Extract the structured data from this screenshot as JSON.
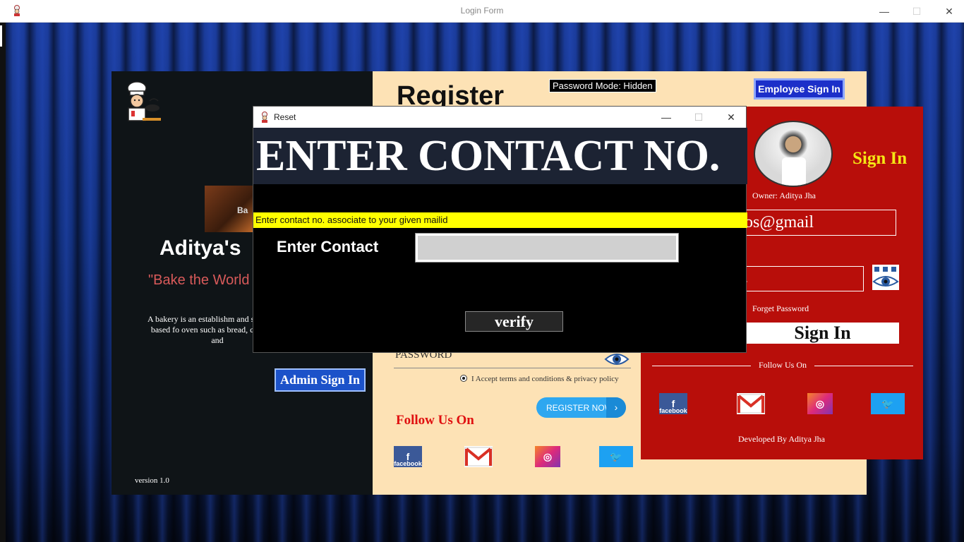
{
  "window": {
    "title": "Login Form",
    "minimize": "—",
    "maximize": "☐",
    "close": "✕"
  },
  "left_panel": {
    "bakery_img_text": "Ba",
    "bakery_name": "Aditya's",
    "tagline": "\"Bake the World",
    "description": "A bakery is an establishm and sells flour-based fo oven such as bread, c pastries, and",
    "admin_button": "Admin Sign In",
    "version": "version 1.0"
  },
  "register_panel": {
    "title": "Register",
    "password_mode": "Password Mode: Hidden",
    "employee_button": "Employee Sign In",
    "password_label": "PASSWORD",
    "terms": "I Accept terms and conditions & privacy policy",
    "register_button": "REGISTER NOW",
    "register_arrow": "›",
    "follow_us": "Follow Us On",
    "social": {
      "facebook": "f",
      "facebook_caption": "facebook",
      "gmail": "M",
      "instagram": "◎",
      "twitter": "🐦"
    }
  },
  "signin_panel": {
    "owner": "Owner: Aditya Jha",
    "title": "Sign In",
    "email_value": "os@gmail",
    "password_value": ".",
    "forget_password": "Forget Password",
    "signin_button": "Sign In",
    "follow_us": "Follow Us On",
    "developed_by": "Developed By Aditya Jha"
  },
  "dialog": {
    "title": "Reset",
    "banner": "ENTER CONTACT NO.",
    "hint": "Enter contact no. associate to your given mailid",
    "contact_label": "Enter Contact",
    "contact_value": "",
    "verify_button": "verify",
    "minimize": "—",
    "maximize": "☐",
    "close": "✕"
  },
  "colors": {
    "register_bg": "#fde2b5",
    "signin_bg": "#b80e0a",
    "hint_bg": "#ffff00",
    "banner_bg": "#1c2333"
  }
}
